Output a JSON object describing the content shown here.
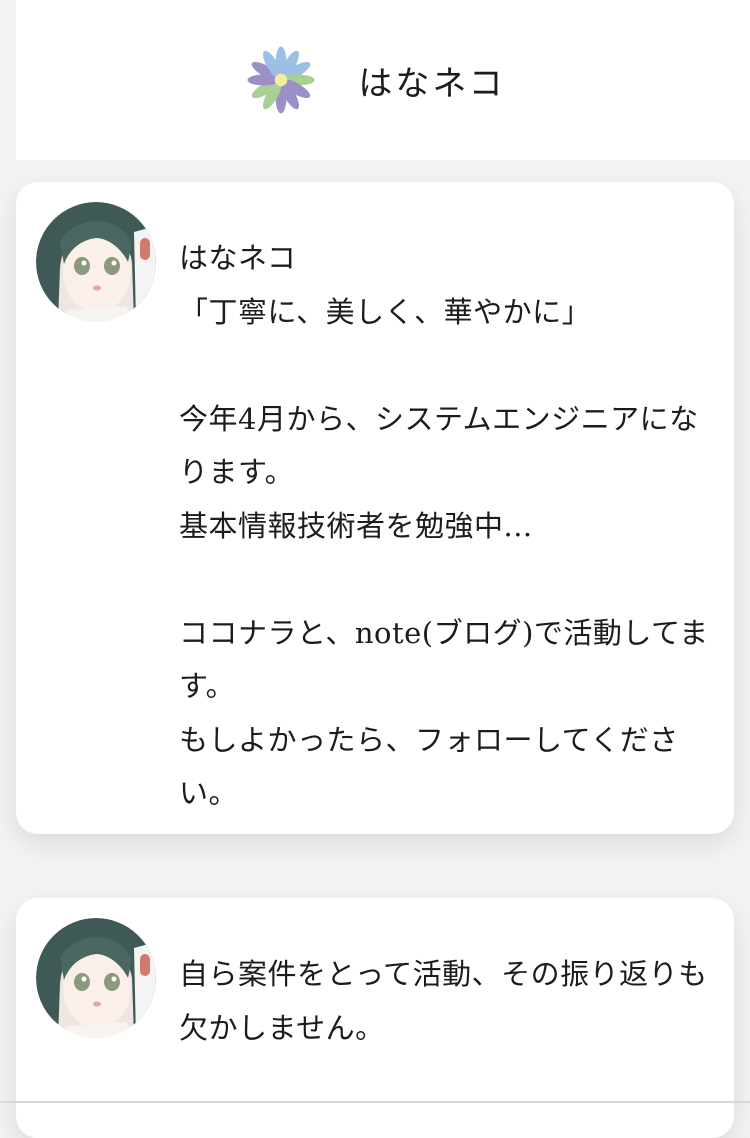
{
  "header": {
    "site_title": "はなネコ",
    "logo_icon": "flower-logo-icon"
  },
  "posts": [
    {
      "avatar_icon": "anime-girl-avatar",
      "text": "はなネコ\n「丁寧に、美しく、華やかに」\n\n今年4月から、システムエンジニアになります。\n基本情報技術者を勉強中...\n\nココナラと、note(ブログ)で活動してます。\nもしよかったら、フォローしてください。"
    },
    {
      "avatar_icon": "anime-girl-avatar",
      "text": "自ら案件をとって活動、その振り返りも欠かしません。"
    }
  ],
  "colors": {
    "background": "#f3f3f5",
    "card": "#ffffff",
    "text": "#1c1c1c",
    "petal_purple": "#9b8fc7",
    "petal_blue": "#9dbfe3",
    "petal_green": "#a9cf92",
    "flower_center": "#f1ef9a"
  }
}
